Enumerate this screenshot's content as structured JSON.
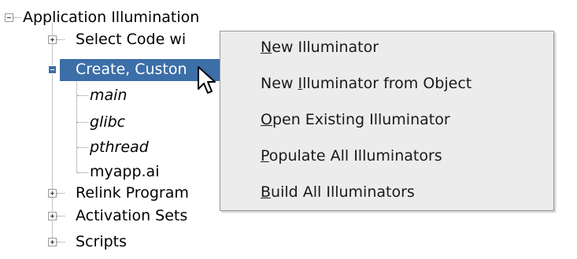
{
  "tree": {
    "root": {
      "label": "Application Illumination"
    },
    "items": [
      {
        "label": "Select Code wi"
      },
      {
        "label": "Create, Custon"
      },
      {
        "label": "main"
      },
      {
        "label": "glibc"
      },
      {
        "label": "pthread"
      },
      {
        "label": "myapp.ai"
      },
      {
        "label": "Relink Program"
      },
      {
        "label": "Activation Sets"
      },
      {
        "label": "Scripts"
      }
    ]
  },
  "context_menu": {
    "items": [
      {
        "pre": "",
        "mnemonic": "N",
        "post": "ew Illuminator"
      },
      {
        "pre": "New ",
        "mnemonic": "I",
        "post": "lluminator from Object"
      },
      {
        "pre": "",
        "mnemonic": "O",
        "post": "pen Existing Illuminator"
      },
      {
        "pre": "",
        "mnemonic": "P",
        "post": "opulate All Illuminators"
      },
      {
        "pre": "",
        "mnemonic": "B",
        "post": "uild All Illuminators"
      }
    ]
  },
  "colors": {
    "selection": "#3c6ea8",
    "menu_background": "#ececec"
  }
}
